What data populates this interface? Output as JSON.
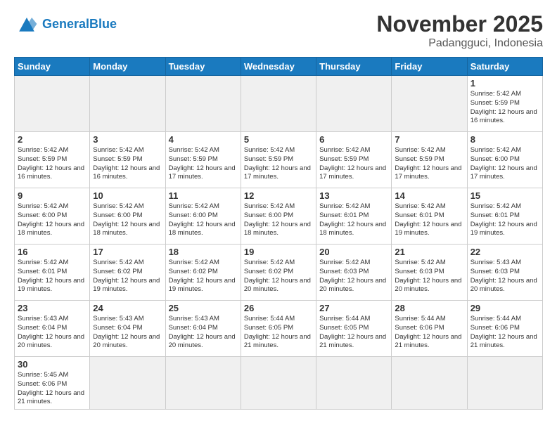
{
  "header": {
    "logo_text_general": "General",
    "logo_text_blue": "Blue",
    "month_title": "November 2025",
    "location": "Padangguci, Indonesia"
  },
  "weekdays": [
    "Sunday",
    "Monday",
    "Tuesday",
    "Wednesday",
    "Thursday",
    "Friday",
    "Saturday"
  ],
  "weeks": [
    [
      {
        "day": "",
        "info": ""
      },
      {
        "day": "",
        "info": ""
      },
      {
        "day": "",
        "info": ""
      },
      {
        "day": "",
        "info": ""
      },
      {
        "day": "",
        "info": ""
      },
      {
        "day": "",
        "info": ""
      },
      {
        "day": "1",
        "info": "Sunrise: 5:42 AM\nSunset: 5:59 PM\nDaylight: 12 hours and 16 minutes."
      }
    ],
    [
      {
        "day": "2",
        "info": "Sunrise: 5:42 AM\nSunset: 5:59 PM\nDaylight: 12 hours and 16 minutes."
      },
      {
        "day": "3",
        "info": "Sunrise: 5:42 AM\nSunset: 5:59 PM\nDaylight: 12 hours and 16 minutes."
      },
      {
        "day": "4",
        "info": "Sunrise: 5:42 AM\nSunset: 5:59 PM\nDaylight: 12 hours and 17 minutes."
      },
      {
        "day": "5",
        "info": "Sunrise: 5:42 AM\nSunset: 5:59 PM\nDaylight: 12 hours and 17 minutes."
      },
      {
        "day": "6",
        "info": "Sunrise: 5:42 AM\nSunset: 5:59 PM\nDaylight: 12 hours and 17 minutes."
      },
      {
        "day": "7",
        "info": "Sunrise: 5:42 AM\nSunset: 5:59 PM\nDaylight: 12 hours and 17 minutes."
      },
      {
        "day": "8",
        "info": "Sunrise: 5:42 AM\nSunset: 6:00 PM\nDaylight: 12 hours and 17 minutes."
      }
    ],
    [
      {
        "day": "9",
        "info": "Sunrise: 5:42 AM\nSunset: 6:00 PM\nDaylight: 12 hours and 18 minutes."
      },
      {
        "day": "10",
        "info": "Sunrise: 5:42 AM\nSunset: 6:00 PM\nDaylight: 12 hours and 18 minutes."
      },
      {
        "day": "11",
        "info": "Sunrise: 5:42 AM\nSunset: 6:00 PM\nDaylight: 12 hours and 18 minutes."
      },
      {
        "day": "12",
        "info": "Sunrise: 5:42 AM\nSunset: 6:00 PM\nDaylight: 12 hours and 18 minutes."
      },
      {
        "day": "13",
        "info": "Sunrise: 5:42 AM\nSunset: 6:01 PM\nDaylight: 12 hours and 18 minutes."
      },
      {
        "day": "14",
        "info": "Sunrise: 5:42 AM\nSunset: 6:01 PM\nDaylight: 12 hours and 19 minutes."
      },
      {
        "day": "15",
        "info": "Sunrise: 5:42 AM\nSunset: 6:01 PM\nDaylight: 12 hours and 19 minutes."
      }
    ],
    [
      {
        "day": "16",
        "info": "Sunrise: 5:42 AM\nSunset: 6:01 PM\nDaylight: 12 hours and 19 minutes."
      },
      {
        "day": "17",
        "info": "Sunrise: 5:42 AM\nSunset: 6:02 PM\nDaylight: 12 hours and 19 minutes."
      },
      {
        "day": "18",
        "info": "Sunrise: 5:42 AM\nSunset: 6:02 PM\nDaylight: 12 hours and 19 minutes."
      },
      {
        "day": "19",
        "info": "Sunrise: 5:42 AM\nSunset: 6:02 PM\nDaylight: 12 hours and 20 minutes."
      },
      {
        "day": "20",
        "info": "Sunrise: 5:42 AM\nSunset: 6:03 PM\nDaylight: 12 hours and 20 minutes."
      },
      {
        "day": "21",
        "info": "Sunrise: 5:42 AM\nSunset: 6:03 PM\nDaylight: 12 hours and 20 minutes."
      },
      {
        "day": "22",
        "info": "Sunrise: 5:43 AM\nSunset: 6:03 PM\nDaylight: 12 hours and 20 minutes."
      }
    ],
    [
      {
        "day": "23",
        "info": "Sunrise: 5:43 AM\nSunset: 6:04 PM\nDaylight: 12 hours and 20 minutes."
      },
      {
        "day": "24",
        "info": "Sunrise: 5:43 AM\nSunset: 6:04 PM\nDaylight: 12 hours and 20 minutes."
      },
      {
        "day": "25",
        "info": "Sunrise: 5:43 AM\nSunset: 6:04 PM\nDaylight: 12 hours and 20 minutes."
      },
      {
        "day": "26",
        "info": "Sunrise: 5:44 AM\nSunset: 6:05 PM\nDaylight: 12 hours and 21 minutes."
      },
      {
        "day": "27",
        "info": "Sunrise: 5:44 AM\nSunset: 6:05 PM\nDaylight: 12 hours and 21 minutes."
      },
      {
        "day": "28",
        "info": "Sunrise: 5:44 AM\nSunset: 6:06 PM\nDaylight: 12 hours and 21 minutes."
      },
      {
        "day": "29",
        "info": "Sunrise: 5:44 AM\nSunset: 6:06 PM\nDaylight: 12 hours and 21 minutes."
      }
    ],
    [
      {
        "day": "30",
        "info": "Sunrise: 5:45 AM\nSunset: 6:06 PM\nDaylight: 12 hours and 21 minutes."
      },
      {
        "day": "",
        "info": ""
      },
      {
        "day": "",
        "info": ""
      },
      {
        "day": "",
        "info": ""
      },
      {
        "day": "",
        "info": ""
      },
      {
        "day": "",
        "info": ""
      },
      {
        "day": "",
        "info": ""
      }
    ]
  ]
}
